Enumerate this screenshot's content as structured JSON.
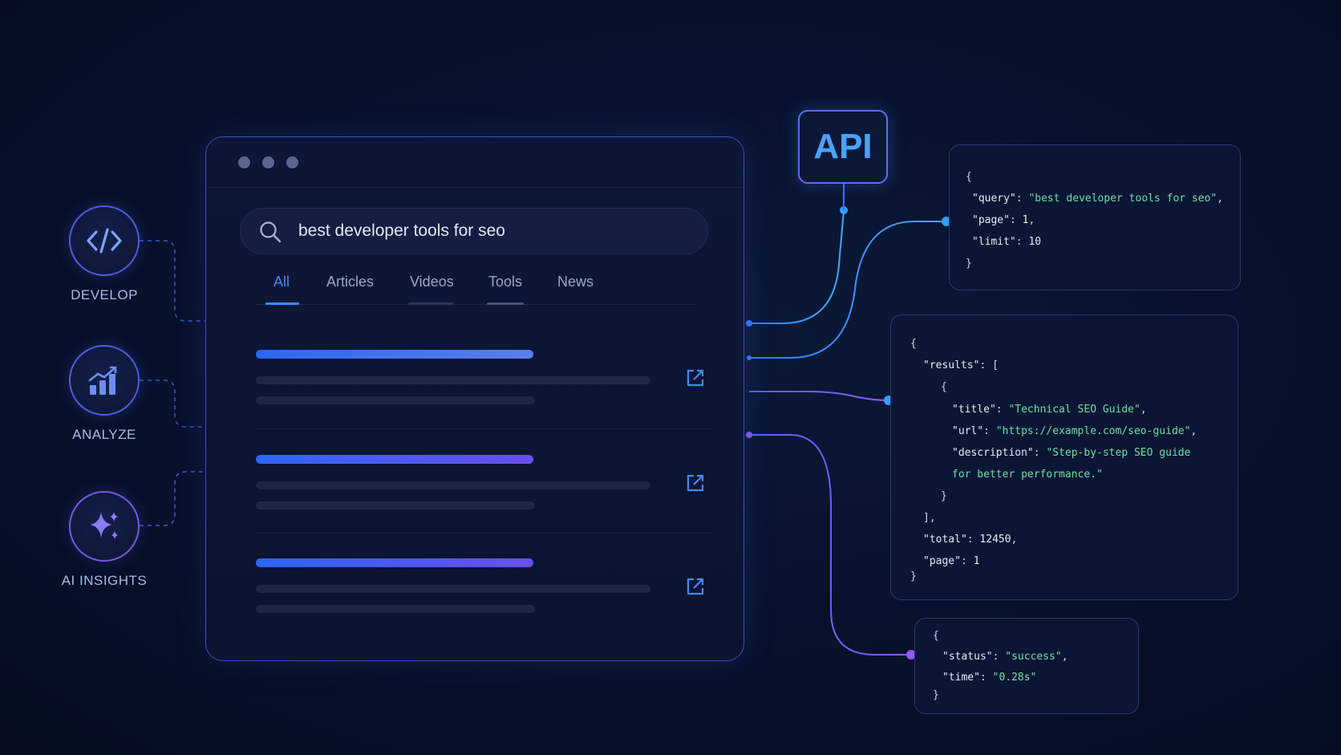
{
  "features": [
    {
      "label": "DEVELOP",
      "icon": "code-icon"
    },
    {
      "label": "ANALYZE",
      "icon": "bar-chart-icon"
    },
    {
      "label": "AI INSIGHTS",
      "icon": "sparkle-icon"
    }
  ],
  "browser": {
    "search": {
      "query": "best developer tools for seo"
    },
    "tabs": [
      {
        "label": "All",
        "active": true
      },
      {
        "label": "Articles",
        "active": false
      },
      {
        "label": "Videos",
        "active": false
      },
      {
        "label": "Tools",
        "active": false
      },
      {
        "label": "News",
        "active": false
      }
    ],
    "result_count": 3
  },
  "api_badge": {
    "label": "API"
  },
  "request_panel": {
    "open": "{",
    "query_key": "\"query\"",
    "query_value": "\"best developer tools for seo\"",
    "page_key": "\"page\"",
    "page_value": "1",
    "limit_key": "\"limit\"",
    "limit_value": "10",
    "close": "}"
  },
  "results_panel": {
    "open": "{",
    "results_key": "\"results\"",
    "array_open": "[",
    "item_open": "{",
    "title_key": "\"title\"",
    "title_value": "\"Technical SEO Guide\"",
    "url_key": "\"url\"",
    "url_value": "\"https://example.com/seo-guide\"",
    "description_key": "\"description\"",
    "description_value_1": "\"Step-by-step SEO guide",
    "description_value_2": "for better performance.\"",
    "item_close": "}",
    "array_close": "],",
    "total_key": "\"total\"",
    "total_value": "12450",
    "page_key": "\"page\"",
    "page_value": "1",
    "close": "}"
  },
  "status_panel": {
    "open": "{",
    "status_key": "\"status\"",
    "status_value": "\"success\"",
    "time_key": "\"time\"",
    "time_value": "\"0.28s\"",
    "close": "}"
  },
  "colors": {
    "accent_blue": "#3d8cff",
    "accent_purple": "#7b56e6",
    "string_green": "#6fe0a2",
    "background": "#081330"
  }
}
